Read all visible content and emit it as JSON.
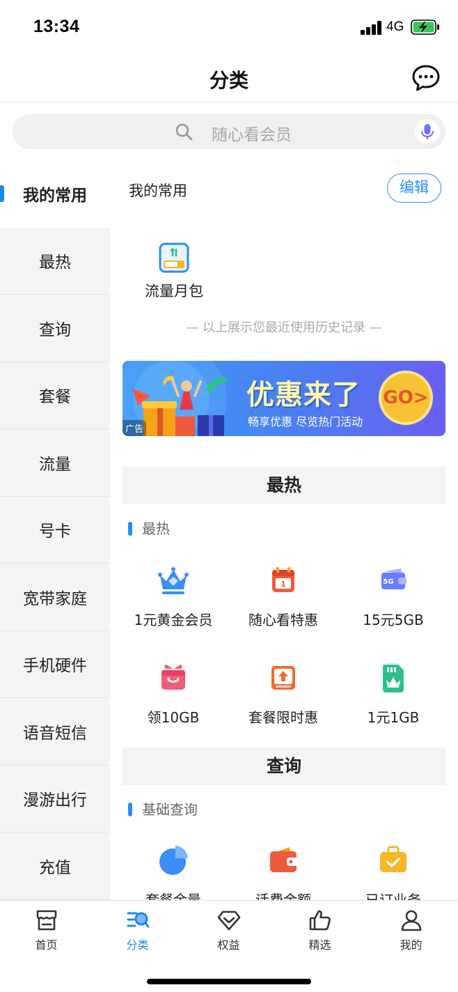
{
  "status_bar": {
    "time": "13:34",
    "network": "4G",
    "icons": [
      "signal-icon",
      "battery-charging-icon"
    ]
  },
  "nav": {
    "title": "分类",
    "chat_icon": "chat-bubble-icon"
  },
  "search": {
    "placeholder": "随心看会员",
    "icon": "search-icon",
    "mic_icon": "microphone-icon"
  },
  "sidebar": {
    "items": [
      {
        "label": "我的常用",
        "active": true
      },
      {
        "label": "最热"
      },
      {
        "label": "查询"
      },
      {
        "label": "套餐"
      },
      {
        "label": "流量"
      },
      {
        "label": "号卡"
      },
      {
        "label": "宽带家庭"
      },
      {
        "label": "手机硬件"
      },
      {
        "label": "语音短信"
      },
      {
        "label": "漫游出行"
      },
      {
        "label": "充值"
      }
    ]
  },
  "favorites": {
    "title": "我的常用",
    "edit_label": "编辑",
    "items": [
      {
        "label": "流量月包",
        "icon": "data-package-icon"
      }
    ],
    "history_note": "— 以上展示您最近使用历史记录 —"
  },
  "banner": {
    "title": "优惠来了",
    "subtitle": "畅享优惠  尽览热门活动",
    "go_label": "GO>",
    "ad_tag": "广告"
  },
  "sections": [
    {
      "title": "最热",
      "subtitle": "最热",
      "items": [
        {
          "label": "1元黄金会员",
          "icon": "crown-icon"
        },
        {
          "label": "随心看特惠",
          "icon": "calendar-coupon-icon"
        },
        {
          "label": "15元5GB",
          "icon": "5g-card-icon"
        },
        {
          "label": "领10GB",
          "icon": "gift-box-icon"
        },
        {
          "label": "套餐限时惠",
          "icon": "upgrade-box-icon"
        },
        {
          "label": "1元1GB",
          "icon": "sim-card-icon"
        }
      ]
    },
    {
      "title": "查询",
      "subtitle": "基础查询",
      "items": [
        {
          "label": "套餐余量",
          "icon": "pie-chart-icon"
        },
        {
          "label": "话费余额",
          "icon": "wallet-icon"
        },
        {
          "label": "已订业务",
          "icon": "briefcase-check-icon"
        }
      ]
    }
  ],
  "tab_bar": {
    "tabs": [
      {
        "label": "首页",
        "icon": "home-store-icon"
      },
      {
        "label": "分类",
        "icon": "category-search-icon",
        "active": true
      },
      {
        "label": "权益",
        "icon": "diamond-icon"
      },
      {
        "label": "精选",
        "icon": "thumbs-up-icon"
      },
      {
        "label": "我的",
        "icon": "user-icon"
      }
    ]
  },
  "colors": {
    "accent": "#1E88E5",
    "sidebar_bg": "#F4F4F4",
    "orange": "#F05A3C",
    "yellow": "#F5B826",
    "green": "#2BC28A"
  }
}
